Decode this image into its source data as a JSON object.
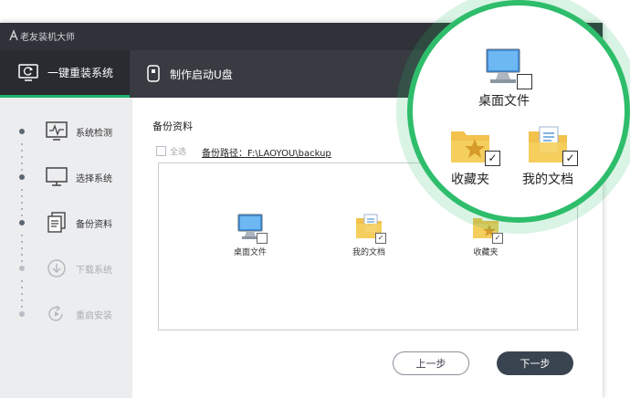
{
  "app": {
    "title": "老友装机大师",
    "close_glyph": "✕"
  },
  "nav": {
    "tabs": [
      {
        "label": "一键重装系统",
        "icon": "refresh-monitor-icon",
        "active": true
      },
      {
        "label": "制作启动U盘",
        "icon": "usb-drive-icon",
        "active": false
      }
    ]
  },
  "sidebar": {
    "steps": [
      {
        "label": "系统检测",
        "icon": "pulse-monitor-icon",
        "enabled": true
      },
      {
        "label": "选择系统",
        "icon": "monitor-icon",
        "enabled": true
      },
      {
        "label": "备份资料",
        "icon": "documents-icon",
        "enabled": true
      },
      {
        "label": "下载系统",
        "icon": "download-circle-icon",
        "enabled": false
      },
      {
        "label": "重启安装",
        "icon": "restart-icon",
        "enabled": false
      }
    ]
  },
  "main": {
    "section_title": "备份资料",
    "select_all_label": "全选",
    "backup_path_label": "备份路径：F:\\LAOYOU\\backup",
    "files": [
      {
        "label": "桌面文件",
        "icon": "desktop-computer-icon",
        "checked": false
      },
      {
        "label": "我的文档",
        "icon": "documents-folder-icon",
        "checked": true
      },
      {
        "label": "收藏夹",
        "icon": "favorites-folder-icon",
        "checked": true
      }
    ],
    "prev_label": "上一步",
    "next_label": "下一步"
  },
  "magnifier": {
    "items": [
      {
        "label": "桌面文件",
        "icon": "desktop-computer-icon",
        "checked": false
      },
      {
        "label": "收藏夹",
        "icon": "favorites-folder-icon",
        "checked": true
      },
      {
        "label": "我的文档",
        "icon": "documents-folder-icon",
        "checked": true
      }
    ]
  },
  "colors": {
    "accent_green": "#2ebd6b",
    "titlebar": "#2f3238",
    "navbar": "#383b42",
    "next_button": "#3a4450"
  }
}
